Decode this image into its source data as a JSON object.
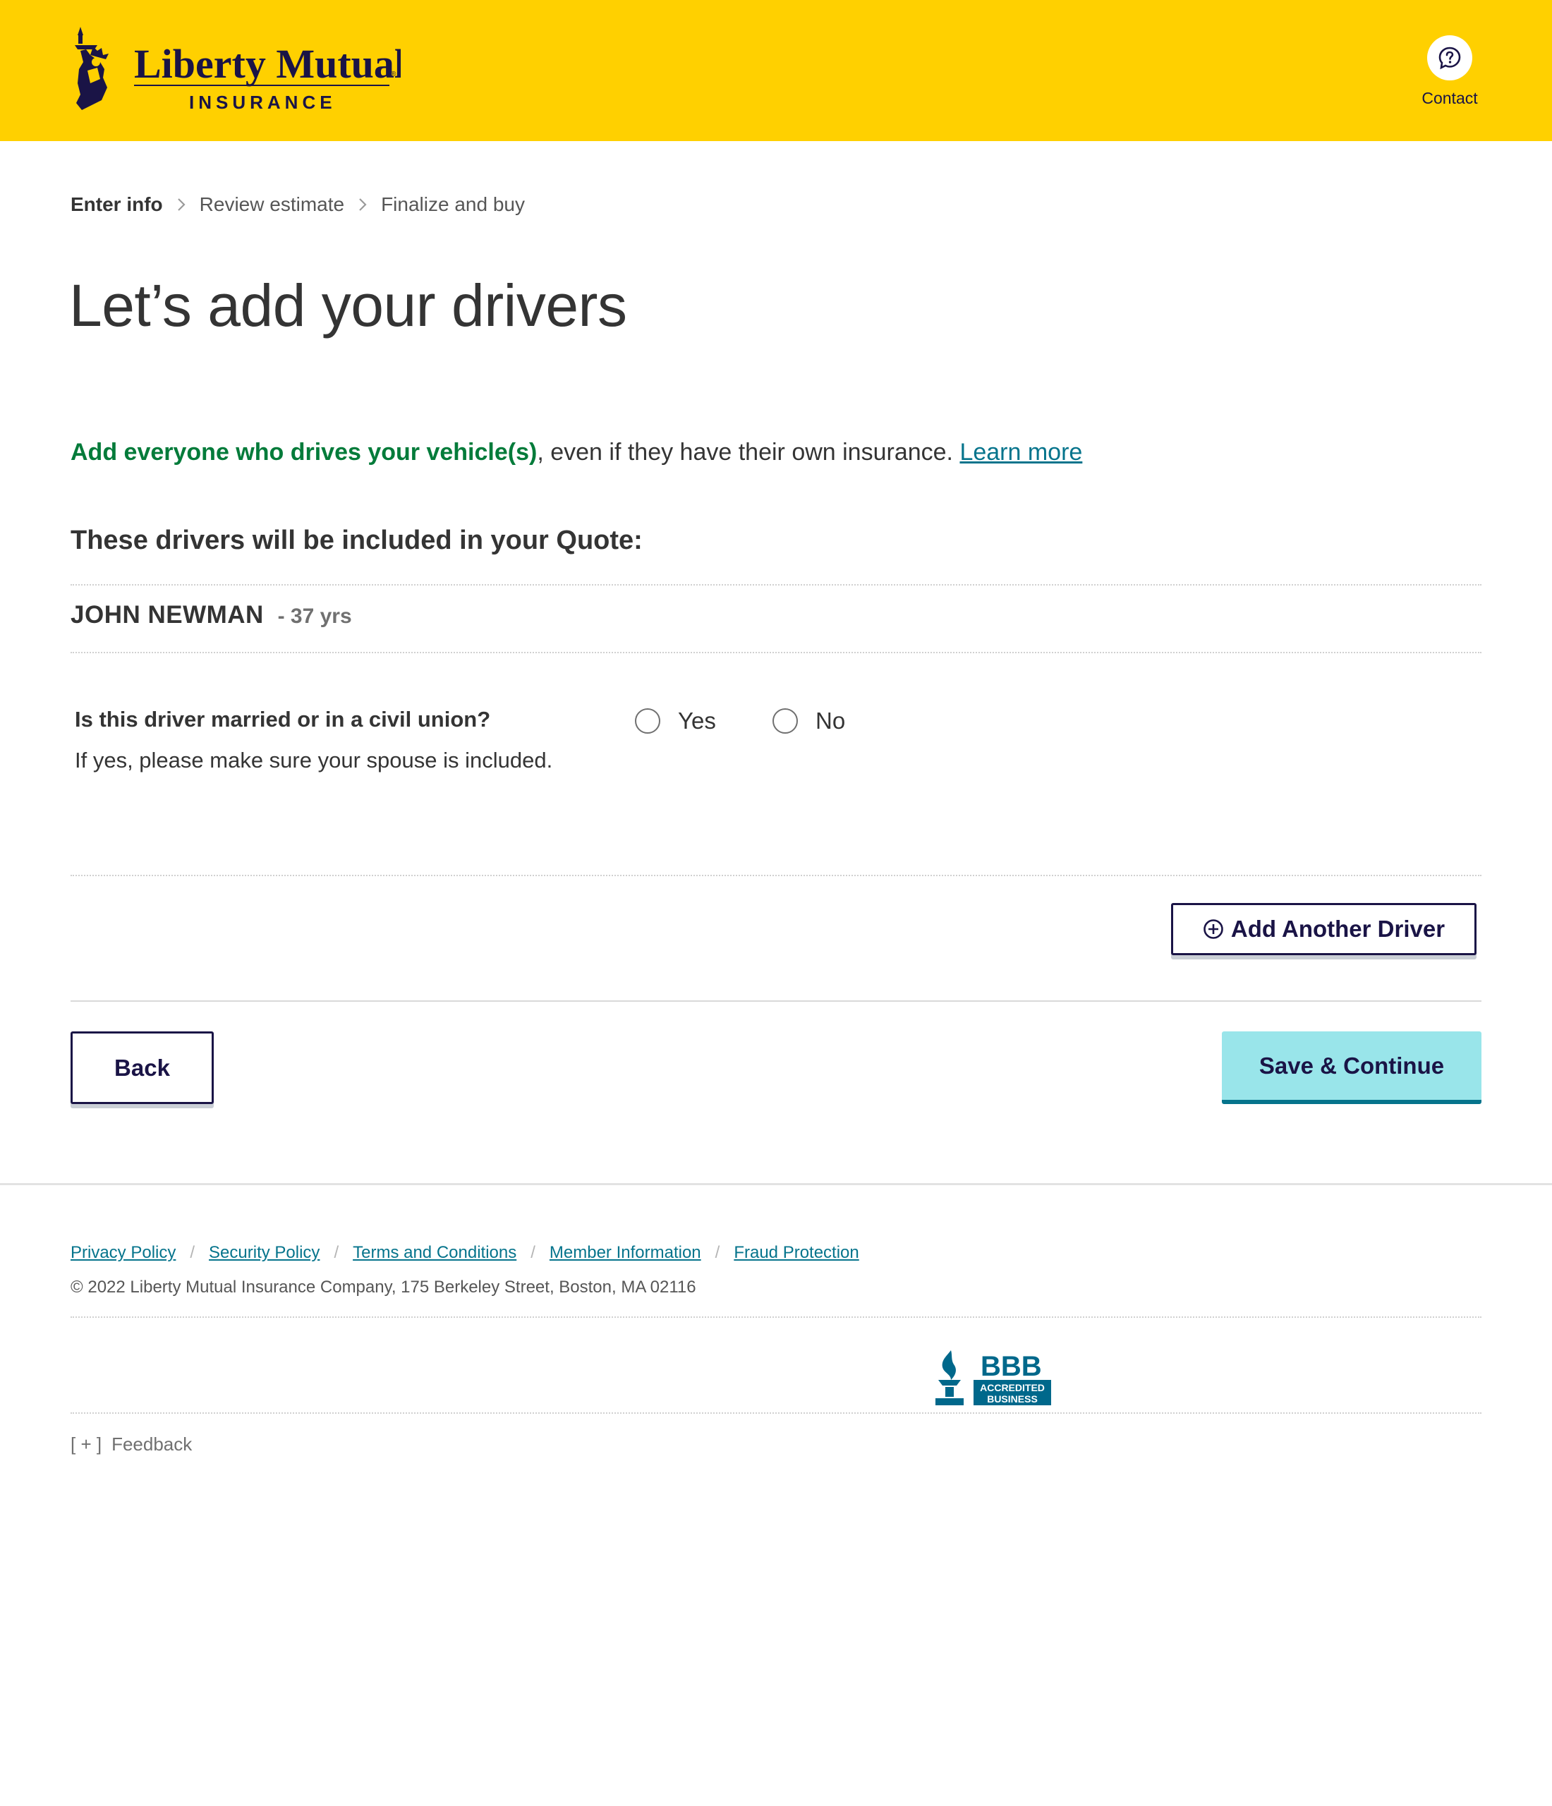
{
  "header": {
    "logo": {
      "brand_line1": "Liberty Mutual",
      "brand_line2": "INSURANCE",
      "icon": "statue-of-liberty-logo"
    },
    "contact": {
      "icon": "question-bubble-icon",
      "label": "Contact"
    }
  },
  "breadcrumb": {
    "steps": [
      {
        "label": "Enter info",
        "active": true
      },
      {
        "label": "Review estimate",
        "active": false
      },
      {
        "label": "Finalize and buy",
        "active": false
      }
    ],
    "separator_icon": "chevron-right-icon"
  },
  "page": {
    "title": "Let’s add your drivers",
    "intro_highlight": "Add everyone who drives your vehicle(s)",
    "intro_rest": ", even if they have their own insurance. ",
    "learn_more": "Learn more",
    "drivers_heading": "These drivers will be included in your Quote:"
  },
  "drivers": [
    {
      "name": "JOHN NEWMAN",
      "age": "- 37 yrs"
    }
  ],
  "question": {
    "text": "Is this driver married or in a civil union?",
    "help": "If yes, please make sure your spouse is included.",
    "options": [
      "Yes",
      "No"
    ],
    "selected": null
  },
  "buttons": {
    "add_driver": "Add Another Driver",
    "add_driver_icon": "plus-circle-icon",
    "back": "Back",
    "save_continue": "Save & Continue"
  },
  "footer": {
    "links": [
      "Privacy Policy",
      "Security Policy",
      "Terms and Conditions",
      "Member Information",
      "Fraud Protection"
    ],
    "separator": "/",
    "copyright": "© 2022 Liberty Mutual Insurance Company, 175 Berkeley Street, Boston, MA 02116",
    "bbb": {
      "line1": "BBB",
      "line2": "ACCREDITED",
      "line3": "BUSINESS"
    },
    "feedback": {
      "bracket": "[ + ]",
      "label": "Feedback"
    }
  },
  "colors": {
    "header_bg": "#ffd000",
    "brand_navy": "#1a1446",
    "link_teal": "#06748c",
    "highlight_green": "#037b3a",
    "primary_button": "#99e5ea",
    "bbb_blue": "#00688b"
  }
}
